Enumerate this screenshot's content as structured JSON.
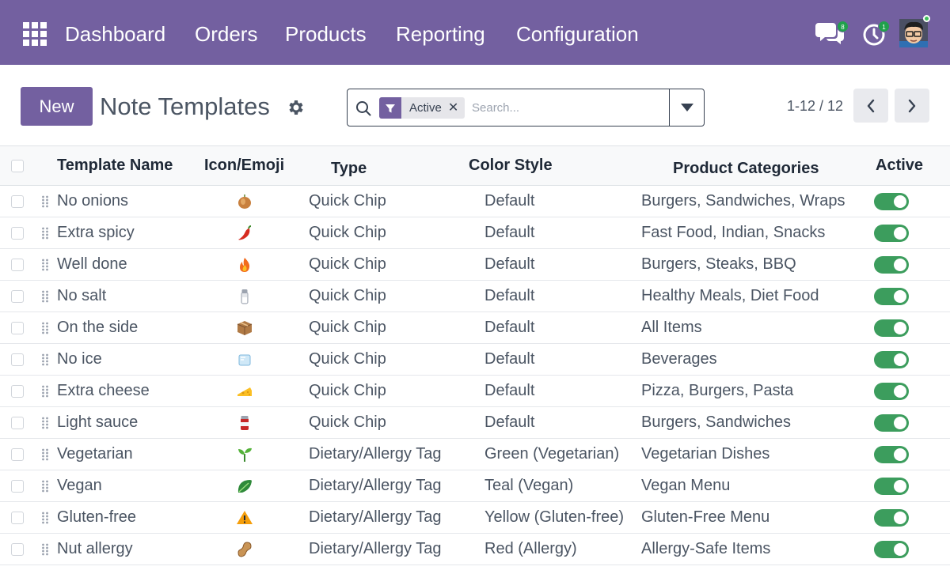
{
  "nav": {
    "menu_items": [
      "Dashboard",
      "Orders",
      "Products",
      "Reporting",
      "Configuration"
    ],
    "chat_badge": "8",
    "activity_badge": "1"
  },
  "control": {
    "new_label": "New",
    "title": "Note Templates",
    "facet_label": "Active",
    "search_placeholder": "Search...",
    "pager": "1-12 / 12"
  },
  "table": {
    "columns": [
      "Template Name",
      "Icon/Emoji",
      "Type",
      "Color Style",
      "Product Categories",
      "Active"
    ],
    "rows": [
      {
        "name": "No onions",
        "icon": "onion-icon",
        "type": "Quick Chip",
        "color": "Default",
        "categories": "Burgers, Sandwiches, Wraps",
        "active": true
      },
      {
        "name": "Extra spicy",
        "icon": "chili-pepper-icon",
        "type": "Quick Chip",
        "color": "Default",
        "categories": "Fast Food, Indian, Snacks",
        "active": true
      },
      {
        "name": "Well done",
        "icon": "fire-icon",
        "type": "Quick Chip",
        "color": "Default",
        "categories": "Burgers, Steaks, BBQ",
        "active": true
      },
      {
        "name": "No salt",
        "icon": "salt-shaker-icon",
        "type": "Quick Chip",
        "color": "Default",
        "categories": "Healthy Meals, Diet Food",
        "active": true
      },
      {
        "name": "On the side",
        "icon": "package-icon",
        "type": "Quick Chip",
        "color": "Default",
        "categories": "All Items",
        "active": true
      },
      {
        "name": "No ice",
        "icon": "ice-cube-icon",
        "type": "Quick Chip",
        "color": "Default",
        "categories": "Beverages",
        "active": true
      },
      {
        "name": "Extra cheese",
        "icon": "cheese-icon",
        "type": "Quick Chip",
        "color": "Default",
        "categories": "Pizza, Burgers, Pasta",
        "active": true
      },
      {
        "name": "Light sauce",
        "icon": "sauce-jar-icon",
        "type": "Quick Chip",
        "color": "Default",
        "categories": "Burgers, Sandwiches",
        "active": true
      },
      {
        "name": "Vegetarian",
        "icon": "seedling-icon",
        "type": "Dietary/Allergy Tag",
        "color": "Green (Vegetarian)",
        "categories": "Vegetarian Dishes",
        "active": true
      },
      {
        "name": "Vegan",
        "icon": "leafy-green-icon",
        "type": "Dietary/Allergy Tag",
        "color": "Teal (Vegan)",
        "categories": "Vegan Menu",
        "active": true
      },
      {
        "name": "Gluten-free",
        "icon": "warning-icon",
        "type": "Dietary/Allergy Tag",
        "color": "Yellow (Gluten-free)",
        "categories": "Gluten-Free Menu",
        "active": true
      },
      {
        "name": "Nut allergy",
        "icon": "peanut-icon",
        "type": "Dietary/Allergy Tag",
        "color": "Red (Allergy)",
        "categories": "Allergy-Safe Items",
        "active": true
      }
    ]
  },
  "colors": {
    "navbar": "#7360a0",
    "primary": "#7360a0",
    "toggle_on": "#3c9d5d",
    "badge": "#21a04c"
  }
}
